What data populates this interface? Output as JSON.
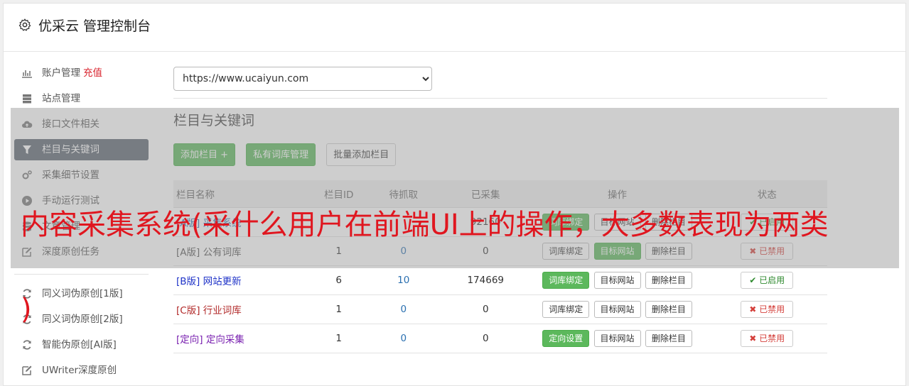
{
  "header": {
    "title": "优采云 管理控制台",
    "icon": "gear-icon"
  },
  "sidebar": {
    "items": [
      {
        "label": "账户管理",
        "badge": "充值",
        "icon": "bar-chart-icon"
      },
      {
        "label": "站点管理",
        "icon": "server-icon"
      },
      {
        "label": "接口文件相关",
        "icon": "cloud-upload-icon"
      },
      {
        "label": "栏目与关键词",
        "icon": "filter-icon",
        "active": true
      },
      {
        "label": "采集细节设置",
        "icon": "cogs-icon"
      },
      {
        "label": "手动运行测试",
        "icon": "play-circle-icon"
      },
      {
        "label": "文章管理",
        "icon": "database-icon"
      },
      {
        "label": "深度原创任务",
        "icon": "edit-icon"
      }
    ],
    "items2": [
      {
        "label": "同义词伪原创[1版]",
        "icon": "refresh-icon"
      },
      {
        "label": "同义词伪原创[2版]",
        "icon": "refresh-icon"
      },
      {
        "label": "智能伪原创[AI版]",
        "icon": "refresh-icon"
      },
      {
        "label": "UWriter深度原创",
        "icon": "edit-icon"
      }
    ]
  },
  "main": {
    "site_select": {
      "value": "https://www.ucaiyun.com"
    },
    "section_title": "栏目与关键词",
    "buttons": {
      "add": "添加栏目 +",
      "private_lib": "私有词库管理",
      "batch_add": "批量添加栏目"
    },
    "table": {
      "headers": {
        "name": "栏目名称",
        "id": "栏目ID",
        "pending": "待抓取",
        "collected": "已采集",
        "ops": "操作",
        "status": "状态"
      },
      "rows": [
        {
          "tag": "[A版]",
          "name": "采集系统",
          "id": "",
          "pending": "",
          "collected": "92160",
          "op1": "词库绑定",
          "op2": "目标网站",
          "op3": "删除栏目",
          "status": "已启用",
          "status_mark": "✔"
        },
        {
          "tag": "[A版]",
          "name": "公有词库",
          "id": "1",
          "pending": "0",
          "collected": "0",
          "op1": "词库绑定",
          "op2": "目标网站",
          "op3": "删除栏目",
          "status": "已禁用",
          "status_mark": "✖"
        },
        {
          "tag": "[B版]",
          "name": "网站更新",
          "id": "6",
          "pending": "10",
          "collected": "174669",
          "op1": "词库绑定",
          "op2": "目标网站",
          "op3": "删除栏目",
          "status": "已启用",
          "status_mark": "✔"
        },
        {
          "tag": "[C版]",
          "name": "行业词库",
          "id": "1",
          "pending": "0",
          "collected": "0",
          "op1": "词库绑定",
          "op2": "目标网站",
          "op3": "删除栏目",
          "status": "已禁用",
          "status_mark": "✖"
        },
        {
          "tag": "[定向]",
          "name": "定向采集",
          "id": "1",
          "pending": "0",
          "collected": "0",
          "op1": "定向设置",
          "op2": "目标网站",
          "op3": "删除栏目",
          "status": "已禁用",
          "status_mark": "✖"
        }
      ]
    }
  },
  "overlay_caption": {
    "line1": "内容采集系统(采什么用户在前端UI上的操作，大多数表现为两类",
    "line2": ")"
  },
  "colors": {
    "accent_green": "#5cb85c",
    "active_nav": "#5b6470",
    "danger": "#d43f3a",
    "caption_red": "#e0161f"
  }
}
